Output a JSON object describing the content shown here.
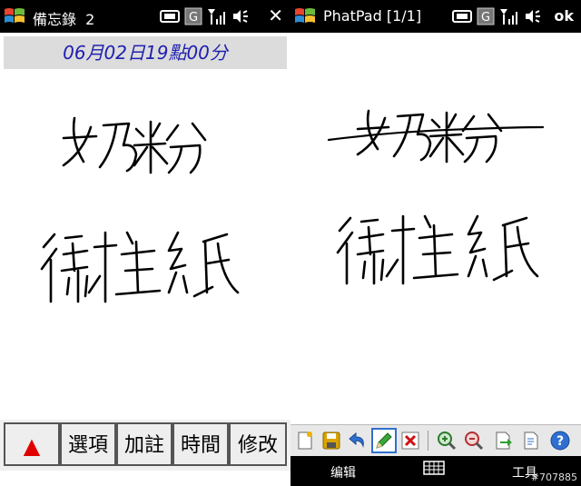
{
  "left_screen": {
    "title": "備忘錄  2",
    "close_label": "✕",
    "date_label": "06月02日19點00分",
    "buttons": [
      {
        "label": "▲",
        "color": "#e00000"
      },
      {
        "label": "選項"
      },
      {
        "label": "加註"
      },
      {
        "label": "時間"
      },
      {
        "label": "修改"
      }
    ]
  },
  "right_screen": {
    "title": "PhatPad [1/1]",
    "ok_label": "ok",
    "softkeys": {
      "left": "编辑",
      "right": "工具"
    },
    "toolbar_icons": [
      "new-note-icon",
      "save-icon",
      "undo-icon",
      "pen-icon",
      "eraser-icon",
      "zoom-in-icon",
      "zoom-out-icon",
      "export-icon",
      "page-icon",
      "help-icon"
    ]
  },
  "status_icons": [
    "keyboard-icon",
    "g-icon",
    "signal-icon",
    "volume-icon"
  ],
  "watermark": "#707885",
  "colors": {
    "titlebar": "#000000",
    "date_text": "#1f1fb0",
    "ink": "#000000"
  }
}
